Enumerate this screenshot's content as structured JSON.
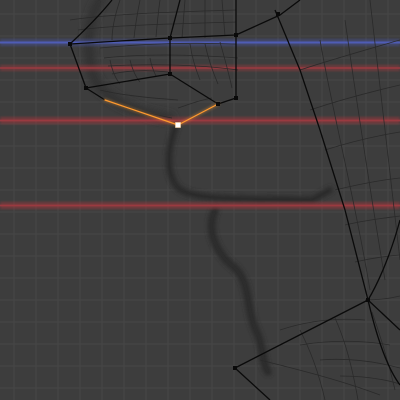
{
  "viewport": {
    "mode": "edit-mode",
    "background_color": "#3d3d3d",
    "grid_color": "#474747",
    "grid_major_color": "#4e4e4e",
    "wire_color": "#0a0a0a",
    "wire_soft_color": "#2a2a2a",
    "selected_edge_color": "#ff9a2e",
    "selected_vertex_color": "#ffffff",
    "reference_line_colors": [
      "#4a56a8",
      "#a8383e"
    ],
    "silhouette_color": "#2c2c2c"
  }
}
